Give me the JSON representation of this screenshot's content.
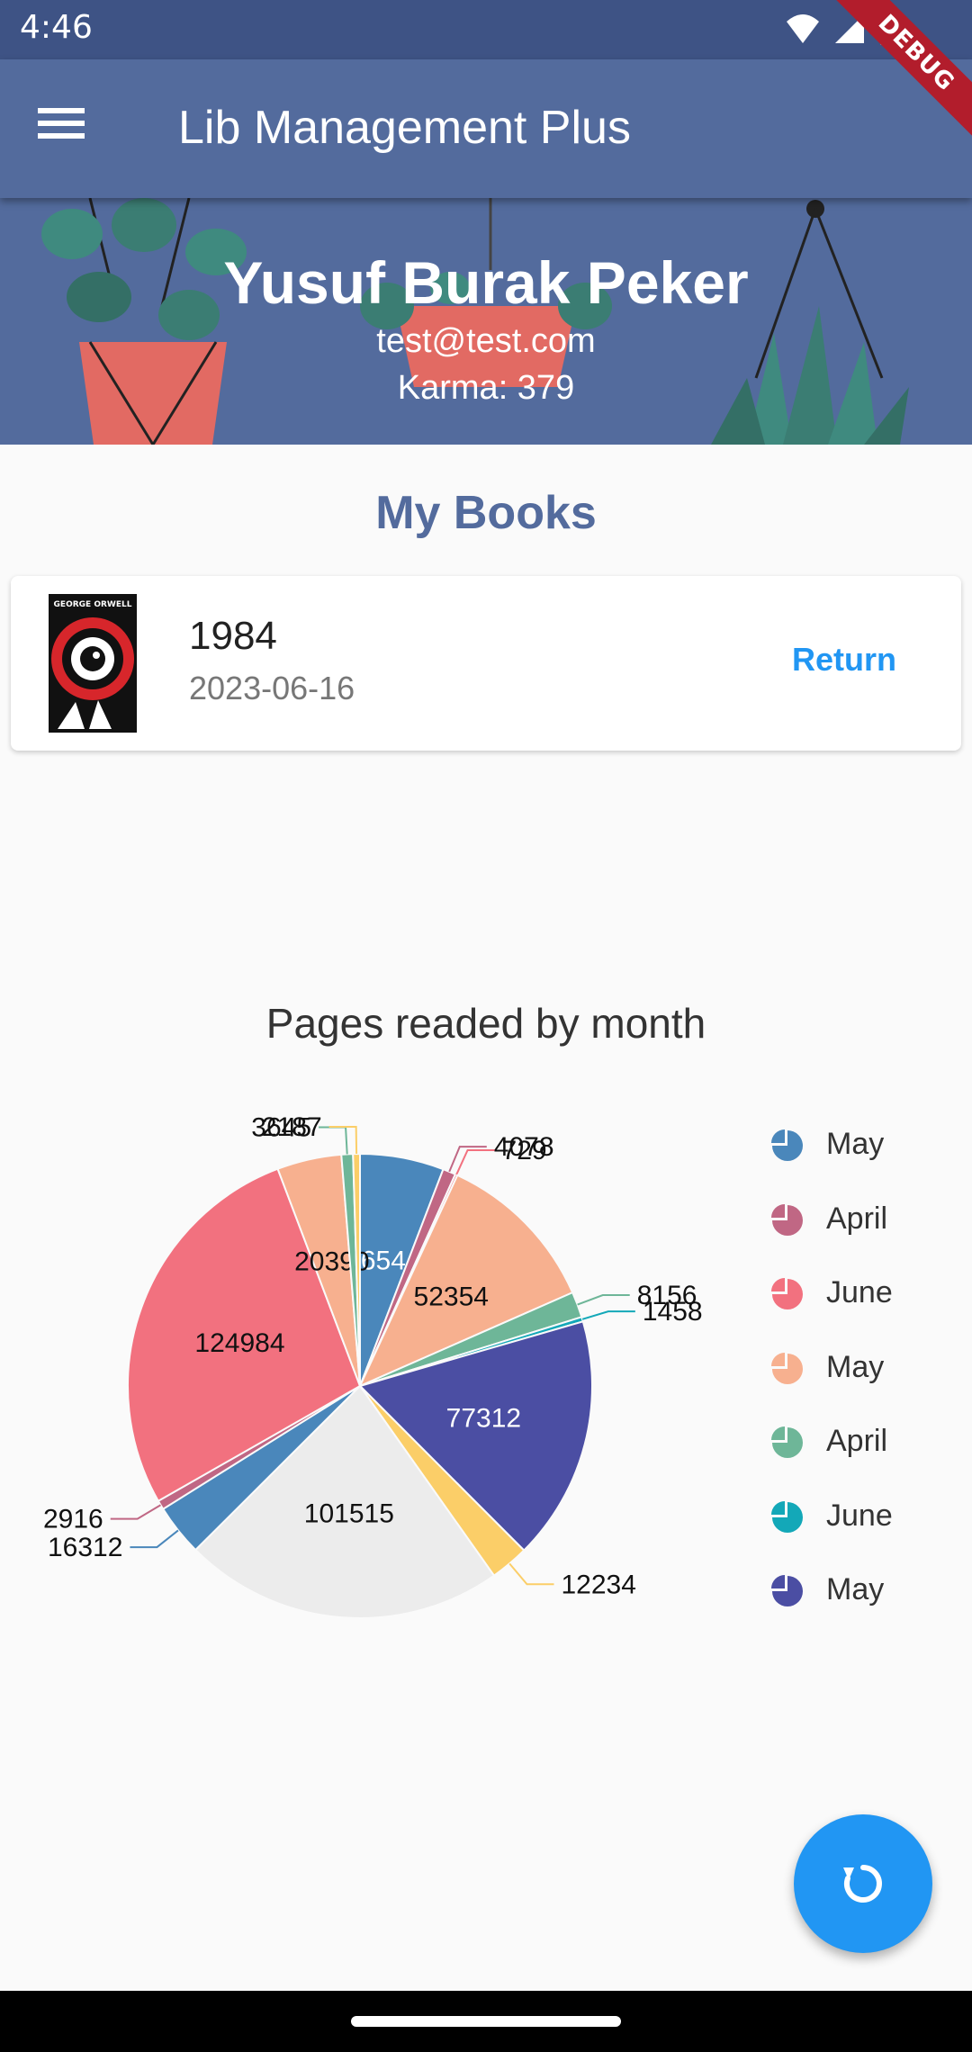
{
  "status_bar": {
    "time": "4:46",
    "debug_label": "DEBUG"
  },
  "app_bar": {
    "title": "Lib Management Plus",
    "menu_icon": "hamburger-icon"
  },
  "profile": {
    "name": "Yusuf Burak Peker",
    "email": "test@test.com",
    "karma": "Karma: 379"
  },
  "books": {
    "title": "My Books",
    "items": [
      {
        "title": "1984",
        "date": "2023-06-16",
        "action": "Return",
        "cover_text": "GEORGE ORWELL"
      }
    ]
  },
  "chart_data": {
    "type": "pie",
    "title": "Pages readed by month",
    "slices": [
      {
        "label": "May",
        "value": 26544,
        "color": "#4a87bb"
      },
      {
        "label": "April",
        "value": 4078,
        "color": "#c06784"
      },
      {
        "label": "June",
        "value": 729,
        "color": "#f2717f"
      },
      {
        "label": "May",
        "value": 52354,
        "color": "#f7b08f"
      },
      {
        "label": "April",
        "value": 8156,
        "color": "#6eb698"
      },
      {
        "label": "June",
        "value": 1458,
        "color": "#13a8b8"
      },
      {
        "label": "May",
        "value": 77312,
        "color": "#4b4ea3"
      },
      {
        "label": "",
        "value": 12234,
        "color": "#fbce68"
      },
      {
        "label": "",
        "value": 101515,
        "color": "#ececec"
      },
      {
        "label": "",
        "value": 16312,
        "color": "#4a87bb"
      },
      {
        "label": "",
        "value": 2916,
        "color": "#c06784"
      },
      {
        "label": "",
        "value": 124984,
        "color": "#f2717f"
      },
      {
        "label": "",
        "value": 20390,
        "color": "#f7b08f"
      },
      {
        "label": "",
        "value": 3645,
        "color": "#6eb698"
      },
      {
        "label": "",
        "value": 2187,
        "color": "#fbce68"
      }
    ],
    "legend": [
      {
        "label": "May",
        "color": "#4a87bb"
      },
      {
        "label": "April",
        "color": "#c06784"
      },
      {
        "label": "June",
        "color": "#f2717f"
      },
      {
        "label": "May",
        "color": "#f7b08f"
      },
      {
        "label": "April",
        "color": "#6eb698"
      },
      {
        "label": "June",
        "color": "#13a8b8"
      },
      {
        "label": "May",
        "color": "#4b4ea3"
      }
    ]
  },
  "fab": {
    "icon": "refresh-icon"
  }
}
